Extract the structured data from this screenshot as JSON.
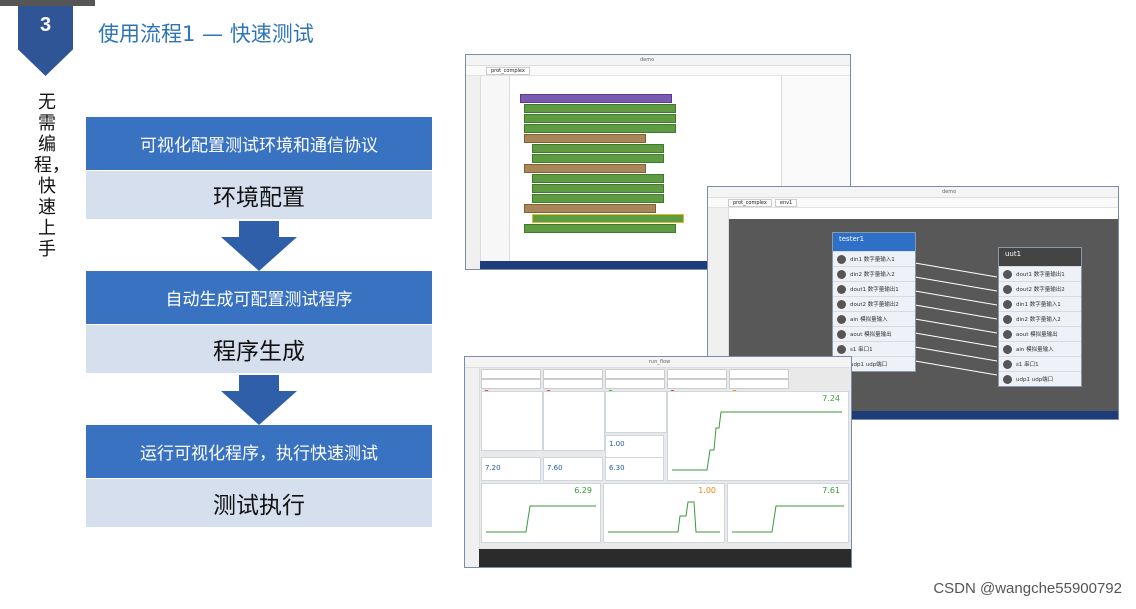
{
  "slide": {
    "number": "3",
    "title": "使用流程1 — 快速测试",
    "vertical_caption": "无需编程，快速上手"
  },
  "flow": [
    {
      "action": "可视化配置测试环境和通信协议",
      "stage": "环境配置"
    },
    {
      "action": "自动生成可配置测试程序",
      "stage": "程序生成"
    },
    {
      "action": "运行可视化程序，执行快速测试",
      "stage": "测试执行"
    }
  ],
  "screens": {
    "protocol": {
      "tab": "prot_complex",
      "window_title": "demo"
    },
    "env": {
      "tab1": "prot_complex",
      "tab2": "env1",
      "window_title": "demo",
      "left_node": {
        "name": "tester1",
        "ports": [
          "din1 数字量输入1",
          "din2 数字量输入2",
          "dout1 数字量输出1",
          "dout2 数字量输出2",
          "ain 模拟量输入",
          "aout 模拟量输出",
          "s1 串口1",
          "udp1 udp端口"
        ]
      },
      "right_node": {
        "name": "uut1",
        "ports": [
          "dout1 数字量输出1",
          "dout2 数字量输出2",
          "din1 数字量输入1",
          "din2 数字量输入2",
          "aout 模拟量输出",
          "ain 模拟量输入",
          "s1 串口1",
          "udp1 udp端口"
        ]
      }
    },
    "run": {
      "window_title": "run_flow",
      "values": [
        "7.24",
        "7.20",
        "7.60",
        "6.30",
        "1.00",
        "6.29",
        "1.00",
        "7.61"
      ]
    }
  },
  "watermark": "CSDN @wangche55900792",
  "colors": {
    "primary": "#3a72c2",
    "light": "#d6dfee",
    "accent": "#2e75b6",
    "marker": "#2f5597"
  }
}
